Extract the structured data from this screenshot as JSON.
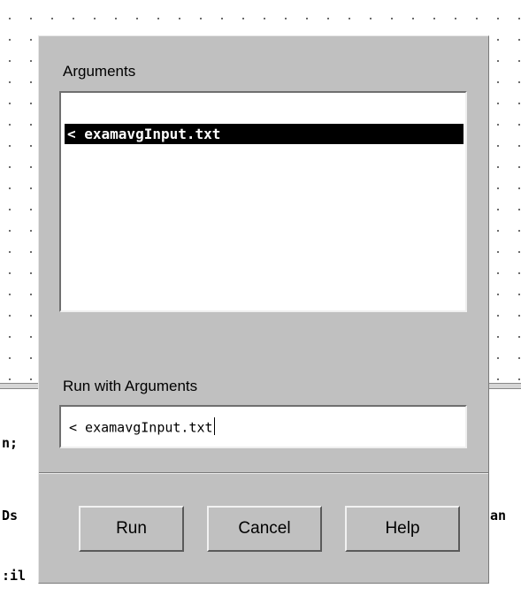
{
  "background": {
    "code_fragments": [
      "n;",
      "Ds",
      ":il",
      "an"
    ]
  },
  "dialog": {
    "arguments_label": "Arguments",
    "arguments_list": [
      {
        "text": "< examavgInput.txt",
        "selected": true
      }
    ],
    "run_with_label": "Run with Arguments",
    "run_with_value": "< examavgInput.txt",
    "buttons": {
      "run": "Run",
      "cancel": "Cancel",
      "help": "Help"
    }
  },
  "colors": {
    "dialog_bg": "#c0c0c0",
    "selection_bg": "#000000",
    "selection_fg": "#ffffff"
  }
}
